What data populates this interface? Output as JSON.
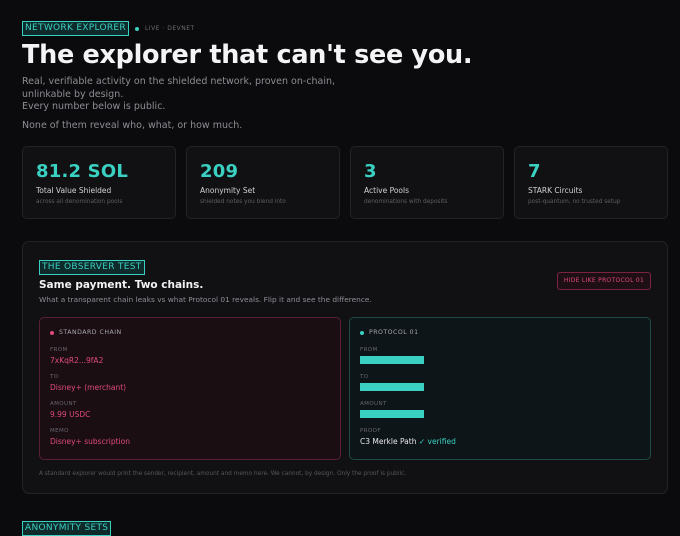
{
  "header": {
    "section_tag": "NETWORK EXPLORER",
    "live_text": "LIVE · DEVNET",
    "title": "The explorer that can't see you.",
    "subtitle": "Real, verifiable activity on the shielded network, proven on-chain, unlinkable by design.",
    "line2": "Every number below is public.",
    "line3": "None of them reveal who, what, or how much."
  },
  "stats": [
    {
      "value": "81.2 SOL",
      "label": "Total Value Shielded",
      "note": "across all denomination pools"
    },
    {
      "value": "209",
      "label": "Anonymity Set",
      "note": "shielded notes you blend into"
    },
    {
      "value": "3",
      "label": "Active Pools",
      "note": "denominations with deposits"
    },
    {
      "value": "7",
      "label": "STARK Circuits",
      "note": "post-quantum, no trusted setup"
    }
  ],
  "observer": {
    "tag": "THE OBSERVER TEST",
    "title": "Same payment. Two chains.",
    "subtitle": "What a transparent chain leaks vs what Protocol 01 reveals. Flip it and see the difference.",
    "button_label": "HIDE LIKE PROTOCOL 01",
    "standard": {
      "name": "STANDARD CHAIN",
      "from_label": "FROM",
      "from_value": "7xKqR2...9fA2",
      "to_label": "TO",
      "to_value": "Disney+ (merchant)",
      "amount_label": "AMOUNT",
      "amount_value": "9.99 USDC",
      "memo_label": "MEMO",
      "memo_value": "Disney+ subscription"
    },
    "protocol": {
      "name": "PROTOCOL 01",
      "from_label": "FROM",
      "to_label": "TO",
      "amount_label": "AMOUNT",
      "proof_label": "PROOF",
      "proof_value": "C3 Merkle Path",
      "proof_status": "✓ verified"
    },
    "footnote": "A standard explorer would print the sender, recipient, amount and memo here. We cannot, by design. Only the proof is public."
  },
  "next_section": {
    "tag": "ANONYMITY SETS"
  },
  "colors": {
    "accent": "#3ad0c2",
    "danger": "#e04a7a",
    "background": "#0b0b0d"
  }
}
